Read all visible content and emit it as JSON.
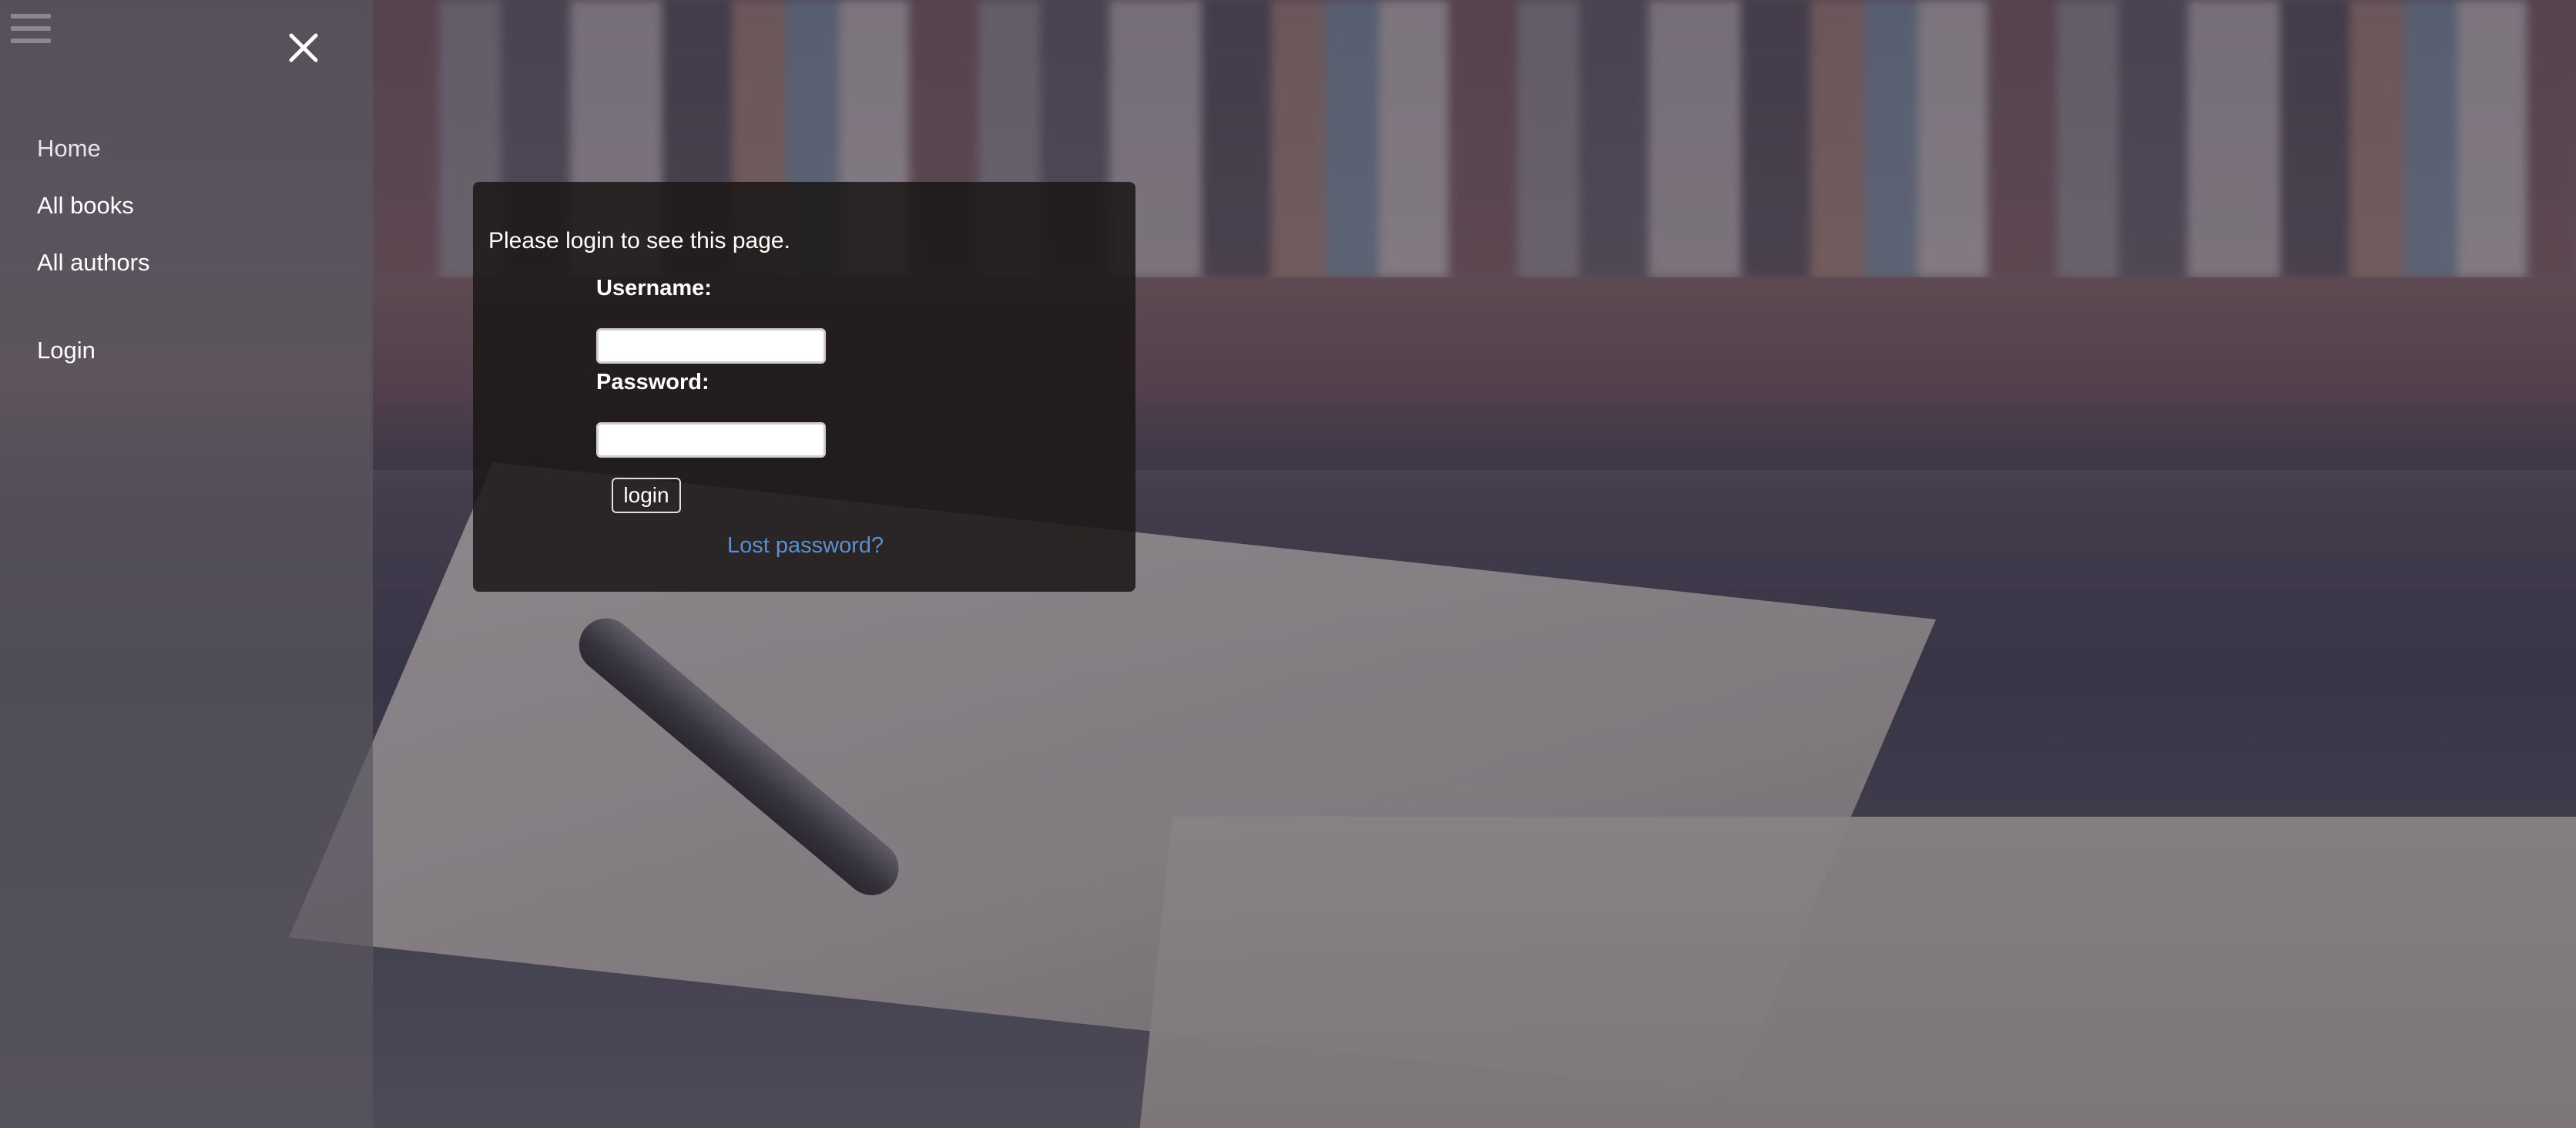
{
  "sidebar": {
    "menu_icon": "hamburger-icon",
    "close_icon": "close-icon",
    "items": [
      {
        "label": "Home"
      },
      {
        "label": "All books"
      },
      {
        "label": "All authors"
      },
      {
        "label": "Login"
      }
    ]
  },
  "login": {
    "message": "Please login to see this page.",
    "username_label": "Username:",
    "username_value": "",
    "password_label": "Password:",
    "password_value": "",
    "submit_label": "login",
    "lost_password_label": "Lost password?"
  },
  "colors": {
    "link": "#5b8fd0",
    "panel_background": "#1c1818",
    "sidebar_background": "#5a5660"
  }
}
